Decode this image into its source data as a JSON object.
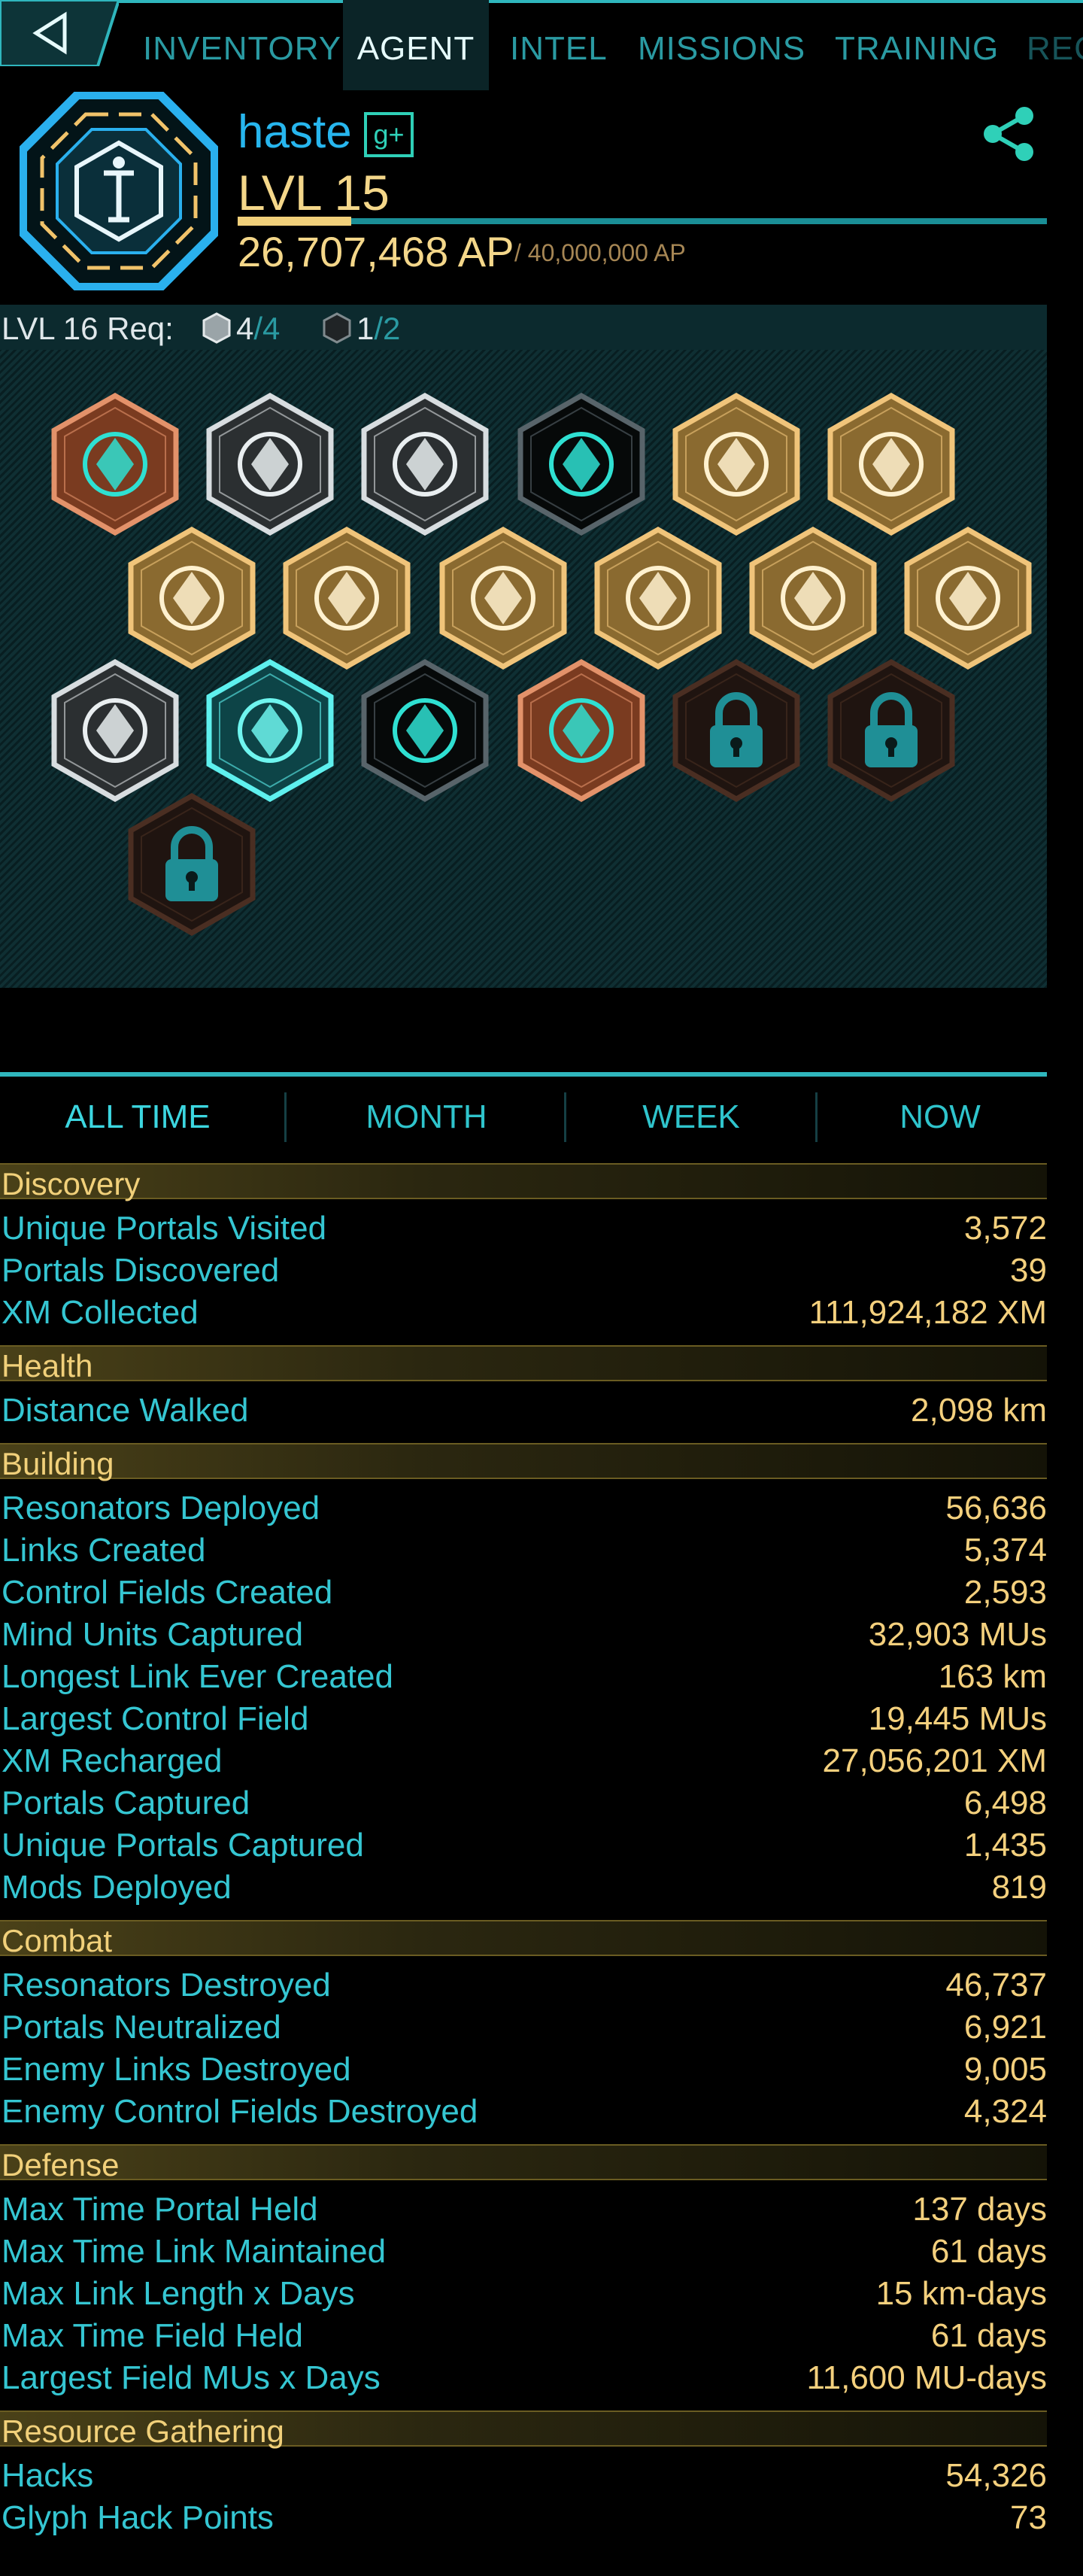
{
  "nav": {
    "tabs": [
      "INVENTORY",
      "AGENT",
      "INTEL",
      "MISSIONS",
      "TRAINING",
      "REC"
    ],
    "active": "AGENT"
  },
  "profile": {
    "name": "haste",
    "gplus_label": "g+",
    "level": "LVL 15",
    "ap": "26,707,468 AP",
    "ap_max": "/ 40,000,000 AP",
    "level_progress": 0.14
  },
  "requirements": {
    "label": "LVL 16 Req:",
    "items": [
      {
        "have": "4",
        "need": "/4",
        "color": "silver"
      },
      {
        "have": "1",
        "need": "/2",
        "color": "dark"
      }
    ]
  },
  "badges": [
    {
      "name": "badge-hacker",
      "tier": "bronze"
    },
    {
      "name": "badge-trekker",
      "tier": "silver"
    },
    {
      "name": "badge-seer",
      "tier": "silver"
    },
    {
      "name": "badge-connector",
      "tier": "onyx"
    },
    {
      "name": "badge-mind-controller",
      "tier": "gold"
    },
    {
      "name": "badge-liberator",
      "tier": "gold"
    },
    {
      "name": "badge-pioneer",
      "tier": "gold"
    },
    {
      "name": "badge-purifier",
      "tier": "gold"
    },
    {
      "name": "badge-engineer",
      "tier": "gold"
    },
    {
      "name": "badge-builder",
      "tier": "gold"
    },
    {
      "name": "badge-explorer",
      "tier": "gold"
    },
    {
      "name": "badge-recharger",
      "tier": "gold"
    },
    {
      "name": "badge-specops",
      "tier": "silver"
    },
    {
      "name": "badge-missionday",
      "tier": "platinum"
    },
    {
      "name": "badge-guardian",
      "tier": "onyx"
    },
    {
      "name": "badge-illuminator",
      "tier": "bronze"
    },
    {
      "name": "badge-locked-1",
      "tier": "locked"
    },
    {
      "name": "badge-locked-2",
      "tier": "locked"
    },
    {
      "name": "badge-locked-3",
      "tier": "locked"
    }
  ],
  "period_tabs": [
    "ALL TIME",
    "MONTH",
    "WEEK",
    "NOW"
  ],
  "sections": [
    {
      "title": "Discovery",
      "rows": [
        {
          "label": "Unique Portals Visited",
          "value": "3,572"
        },
        {
          "label": "Portals Discovered",
          "value": "39"
        },
        {
          "label": "XM Collected",
          "value": "111,924,182 XM"
        }
      ]
    },
    {
      "title": "Health",
      "rows": [
        {
          "label": "Distance Walked",
          "value": "2,098 km"
        }
      ]
    },
    {
      "title": "Building",
      "rows": [
        {
          "label": "Resonators Deployed",
          "value": "56,636"
        },
        {
          "label": "Links Created",
          "value": "5,374"
        },
        {
          "label": "Control Fields Created",
          "value": "2,593"
        },
        {
          "label": "Mind Units Captured",
          "value": "32,903 MUs"
        },
        {
          "label": "Longest Link Ever Created",
          "value": "163 km"
        },
        {
          "label": "Largest Control Field",
          "value": "19,445 MUs"
        },
        {
          "label": "XM Recharged",
          "value": "27,056,201 XM"
        },
        {
          "label": "Portals Captured",
          "value": "6,498"
        },
        {
          "label": "Unique Portals Captured",
          "value": "1,435"
        },
        {
          "label": "Mods Deployed",
          "value": "819"
        }
      ]
    },
    {
      "title": "Combat",
      "rows": [
        {
          "label": "Resonators Destroyed",
          "value": "46,737"
        },
        {
          "label": "Portals Neutralized",
          "value": "6,921"
        },
        {
          "label": "Enemy Links Destroyed",
          "value": "9,005"
        },
        {
          "label": "Enemy Control Fields Destroyed",
          "value": "4,324"
        }
      ]
    },
    {
      "title": "Defense",
      "rows": [
        {
          "label": "Max Time Portal Held",
          "value": "137 days"
        },
        {
          "label": "Max Time Link Maintained",
          "value": "61 days"
        },
        {
          "label": "Max Link Length x Days",
          "value": "15 km-days"
        },
        {
          "label": "Max Time Field Held",
          "value": "61 days"
        },
        {
          "label": "Largest Field MUs x Days",
          "value": "11,600 MU-days"
        }
      ]
    },
    {
      "title": "Resource Gathering",
      "rows": [
        {
          "label": "Hacks",
          "value": "54,326"
        },
        {
          "label": "Glyph Hack Points",
          "value": "73"
        }
      ]
    }
  ]
}
